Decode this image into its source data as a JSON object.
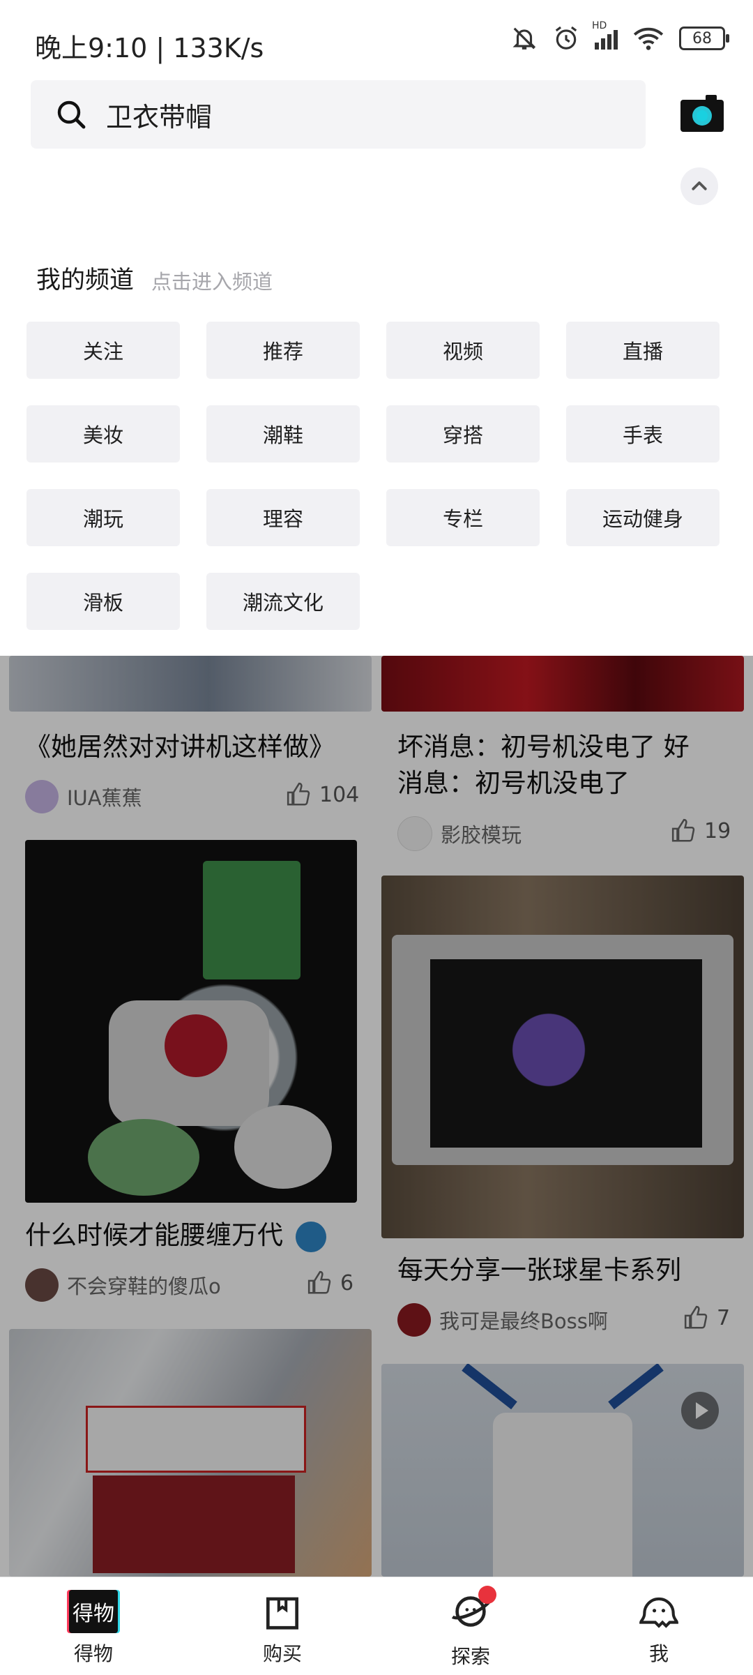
{
  "status_bar": {
    "time_speed": "晚上9:10 | 133K/s",
    "network": "HD",
    "battery": "68"
  },
  "search": {
    "query": "卫衣带帽"
  },
  "channels": {
    "title": "我的频道",
    "hint": "点击进入频道",
    "items": [
      "关注",
      "推荐",
      "视频",
      "直播",
      "美妆",
      "潮鞋",
      "穿搭",
      "手表",
      "潮玩",
      "理容",
      "专栏",
      "运动健身",
      "滑板",
      "潮流文化"
    ]
  },
  "feed": {
    "left": [
      {
        "title": "《她居然对对讲机这样做》",
        "author": "IUA蕉蕉",
        "likes": "104"
      },
      {
        "title": "什么时候才能腰缠万代",
        "author": "不会穿鞋的傻瓜o",
        "likes": "6"
      }
    ],
    "right": [
      {
        "title_line1": "坏消息：初号机没电了 好",
        "title_line2": "消息：初号机没电了",
        "author": "影胶模玩",
        "likes": "19"
      },
      {
        "title": "每天分享一张球星卡系列",
        "author": "我可是最终Boss啊",
        "likes": "7"
      }
    ]
  },
  "nav": {
    "items": [
      {
        "label": "得物",
        "icon": "dewu-logo-icon"
      },
      {
        "label": "购买",
        "icon": "shopping-bag-icon"
      },
      {
        "label": "探索",
        "icon": "planet-icon"
      },
      {
        "label": "我",
        "icon": "profile-mascot-icon"
      }
    ]
  }
}
